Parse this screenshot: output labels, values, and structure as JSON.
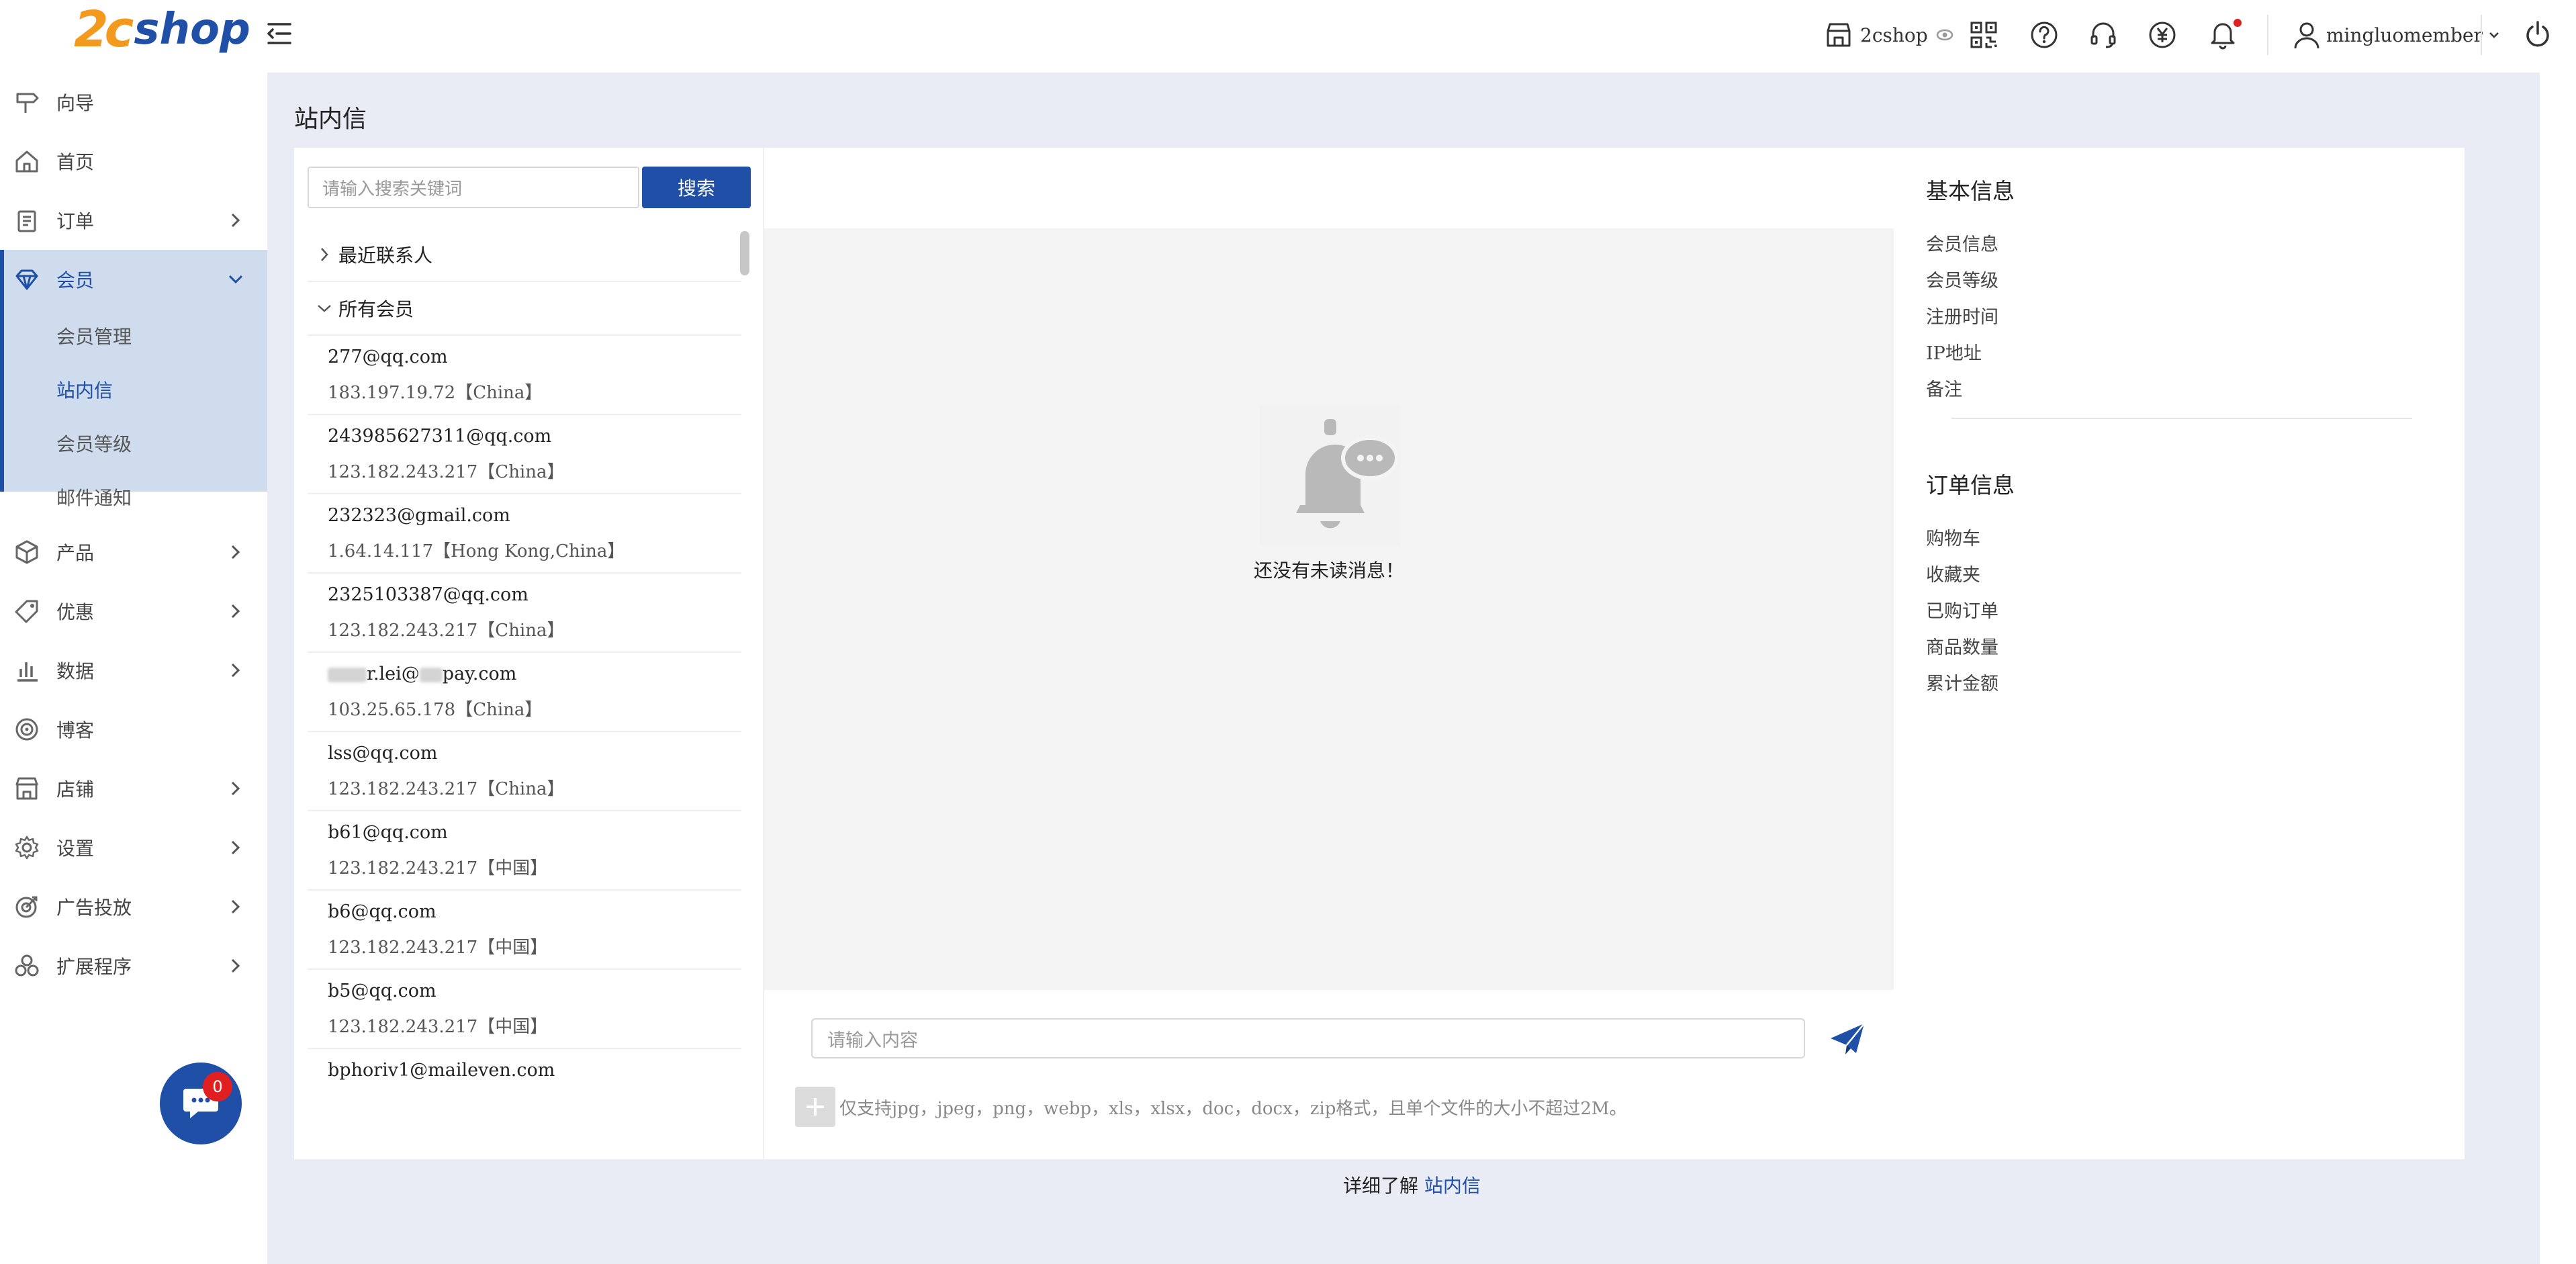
{
  "header": {
    "logo_num": "2c",
    "logo_text": "shop",
    "store_name": "2cshop",
    "username": "mingluomember"
  },
  "sidebar": {
    "items": [
      {
        "label": "向导",
        "icon": "signpost-icon"
      },
      {
        "label": "首页",
        "icon": "home-icon"
      },
      {
        "label": "订单",
        "icon": "clipboard-icon"
      },
      {
        "label": "会员",
        "icon": "diamond-icon"
      },
      {
        "label": "产品",
        "icon": "cube-icon"
      },
      {
        "label": "优惠",
        "icon": "tag-icon"
      },
      {
        "label": "数据",
        "icon": "bar-chart-icon"
      },
      {
        "label": "博客",
        "icon": "target-icon"
      },
      {
        "label": "店铺",
        "icon": "store-icon"
      },
      {
        "label": "设置",
        "icon": "gear-icon"
      },
      {
        "label": "广告投放",
        "icon": "aim-icon"
      },
      {
        "label": "扩展程序",
        "icon": "extensions-icon"
      }
    ],
    "member_sub": [
      "会员管理",
      "站内信",
      "会员等级",
      "邮件通知"
    ],
    "chat_badge": "0"
  },
  "page": {
    "title": "站内信"
  },
  "search": {
    "placeholder": "请输入搜索关键词",
    "button": "搜索"
  },
  "contacts": {
    "recent_label": "最近联系人",
    "all_label": "所有会员",
    "members": [
      {
        "email": "277@qq.com",
        "ip": "183.197.19.72【China】"
      },
      {
        "email": "243985627311@qq.com",
        "ip": "123.182.243.217【China】"
      },
      {
        "email": "232323@gmail.com",
        "ip": "1.64.14.117【Hong Kong,China】"
      },
      {
        "email": "2325103387@qq.com",
        "ip": "123.182.243.217【China】"
      },
      {
        "email_a": "r.lei@",
        "email_b": "pay.com",
        "ip": "103.25.65.178【China】"
      },
      {
        "email": "lss@qq.com",
        "ip": "123.182.243.217【China】"
      },
      {
        "email": "b61@qq.com",
        "ip": "123.182.243.217【中国】"
      },
      {
        "email": "b6@qq.com",
        "ip": "123.182.243.217【中国】"
      },
      {
        "email": "b5@qq.com",
        "ip": "123.182.243.217【中国】"
      },
      {
        "email": "bphoriv1@maileven.com",
        "ip": ""
      }
    ]
  },
  "chat": {
    "empty_text": "还没有未读消息！",
    "input_placeholder": "请输入内容",
    "attach_hint": "仅支持jpg，jpeg，png，webp，xls，xlsx，doc，docx，zip格式，且单个文件的大小不超过2M。"
  },
  "info": {
    "basic_title": "基本信息",
    "basic_items": [
      "会员信息",
      "会员等级",
      "注册时间",
      "IP地址",
      "备注"
    ],
    "order_title": "订单信息",
    "order_items": [
      "购物车",
      "收藏夹",
      "已购订单",
      "商品数量",
      "累计金额"
    ]
  },
  "footer": {
    "prefix": "详细了解",
    "link": "站内信"
  },
  "colors": {
    "brand_blue": "#1f4fa6",
    "brand_orange": "#f39a1e",
    "sidebar_active_bg": "#cfdcee",
    "badge_red": "#e02020"
  }
}
